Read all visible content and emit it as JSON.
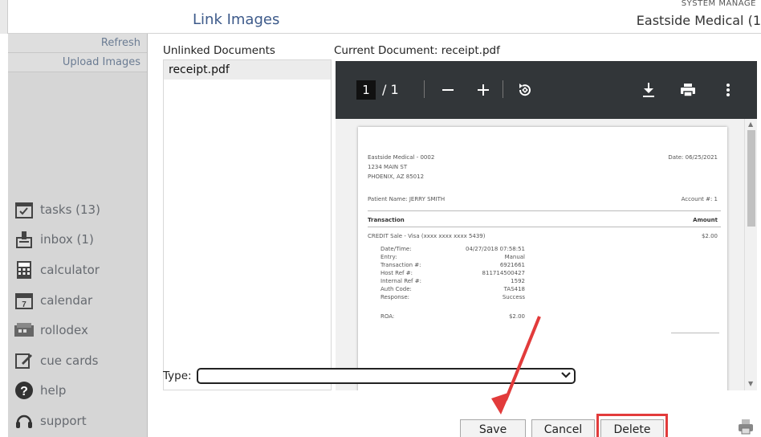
{
  "header": {
    "title": "Link Images",
    "system_label": "SYSTEM MANAGE",
    "clinic": "Eastside Medical (1"
  },
  "sidebar": {
    "links": [
      "Refresh",
      "Upload Images"
    ],
    "nav": [
      {
        "label": "tasks (13)",
        "icon": "tasks-icon"
      },
      {
        "label": "inbox (1)",
        "icon": "inbox-icon"
      },
      {
        "label": "calculator",
        "icon": "calculator-icon"
      },
      {
        "label": "calendar",
        "icon": "calendar-icon"
      },
      {
        "label": "rollodex",
        "icon": "rolodex-icon"
      },
      {
        "label": "cue cards",
        "icon": "cue-cards-icon"
      },
      {
        "label": "help",
        "icon": "help-icon"
      },
      {
        "label": "support",
        "icon": "support-icon"
      }
    ]
  },
  "unlinked": {
    "heading": "Unlinked Documents",
    "items": [
      "receipt.pdf"
    ]
  },
  "viewer": {
    "heading": "Current Document: receipt.pdf",
    "page_current": "1",
    "page_total": "/ 1",
    "receipt": {
      "company": "Eastside Medical - 0002",
      "address1": "1234 MAIN ST",
      "address2": "PHOENIX, AZ 85012",
      "date": "Date: 06/25/2021",
      "patient": "Patient Name: JERRY SMITH",
      "account": "Account #: 1",
      "col_transaction": "Transaction",
      "col_amount": "Amount",
      "line": "CREDIT Sale - Visa (xxxx xxxx xxxx 5439)",
      "line_amount": "$2.00",
      "details": [
        {
          "k": "Date/Time:",
          "v": "04/27/2018 07:58:51"
        },
        {
          "k": "Entry:",
          "v": "Manual"
        },
        {
          "k": "Transaction #:",
          "v": "6921661"
        },
        {
          "k": "Host Ref #:",
          "v": "811714500427"
        },
        {
          "k": "Internal Ref #:",
          "v": "1592"
        },
        {
          "k": "Auth Code:",
          "v": "TAS418"
        },
        {
          "k": "Response:",
          "v": "Success"
        }
      ],
      "roa_label": "ROA:",
      "roa_value": "$2.00"
    }
  },
  "form": {
    "type_label": "Type:",
    "type_value": ""
  },
  "buttons": {
    "save": "Save",
    "cancel": "Cancel",
    "delete": "Delete"
  },
  "colors": {
    "accent_title": "#3d5a8a",
    "highlight": "#e23b3b",
    "viewer_toolbar": "#323639"
  }
}
